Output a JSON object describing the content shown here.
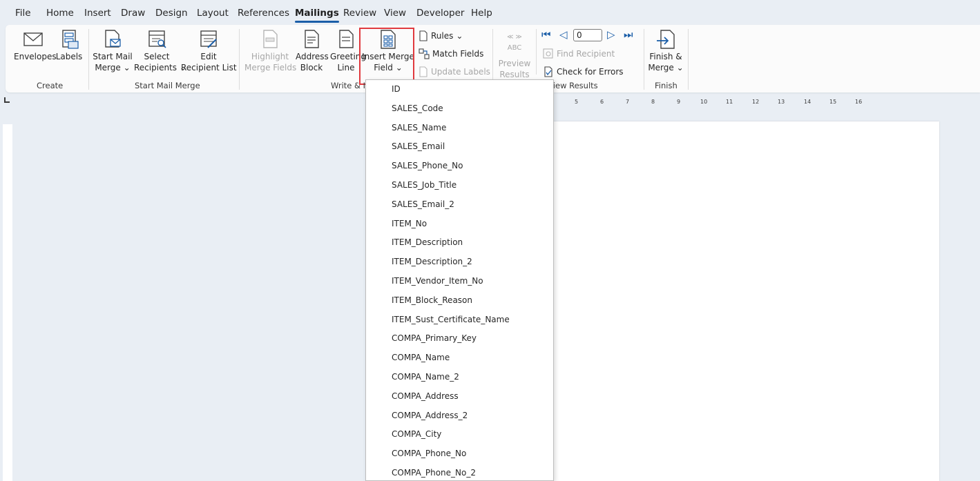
{
  "menu_tabs": [
    "File",
    "Home",
    "Insert",
    "Draw",
    "Design",
    "Layout",
    "References",
    "Mailings",
    "Review",
    "View",
    "Developer",
    "Help"
  ],
  "active_tab": "Mailings",
  "ribbon": {
    "create": {
      "envelopes": "Envelopes",
      "labels": "Labels",
      "group": "Create"
    },
    "start_mail_merge": {
      "start_line1": "Start Mail",
      "start_line2": "Merge",
      "select_line1": "Select",
      "select_line2": "Recipients",
      "edit_line1": "Edit",
      "edit_line2": "Recipient List",
      "group": "Start Mail Merge"
    },
    "write_insert": {
      "highlight_line1": "Highlight",
      "highlight_line2": "Merge Fields",
      "address_line1": "Address",
      "address_line2": "Block",
      "greeting_line1": "Greeting",
      "greeting_line2": "Line",
      "insert_line1": "Insert Merge",
      "insert_line2": "Field",
      "rules": "Rules",
      "match_fields": "Match Fields",
      "update_labels": "Update Labels",
      "group": "Write & In"
    },
    "preview": {
      "abc": "ABC",
      "preview_line1": "Preview",
      "preview_line2": "Results",
      "record_value": "0",
      "find_recipient": "Find Recipient",
      "check_errors": "Check for Errors",
      "group": "view Results"
    },
    "finish": {
      "finish_line1": "Finish &",
      "finish_line2": "Merge",
      "group": "Finish"
    }
  },
  "ruler_ticks": [
    "5",
    "6",
    "7",
    "8",
    "9",
    "10",
    "11",
    "12",
    "13",
    "14",
    "15",
    "16"
  ],
  "merge_fields": [
    "ID",
    "SALES_Code",
    "SALES_Name",
    "SALES_Email",
    "SALES_Phone_No",
    "SALES_Job_Title",
    "SALES_Email_2",
    "ITEM_No",
    "ITEM_Description",
    "ITEM_Description_2",
    "ITEM_Vendor_Item_No",
    "ITEM_Block_Reason",
    "ITEM_Sust_Certificate_Name",
    "COMPA_Primary_Key",
    "COMPA_Name",
    "COMPA_Name_2",
    "COMPA_Address",
    "COMPA_Address_2",
    "COMPA_City",
    "COMPA_Phone_No",
    "COMPA_Phone_No_2"
  ],
  "colors": {
    "accent": "#1b5ea8",
    "highlight": "#e0393e"
  }
}
